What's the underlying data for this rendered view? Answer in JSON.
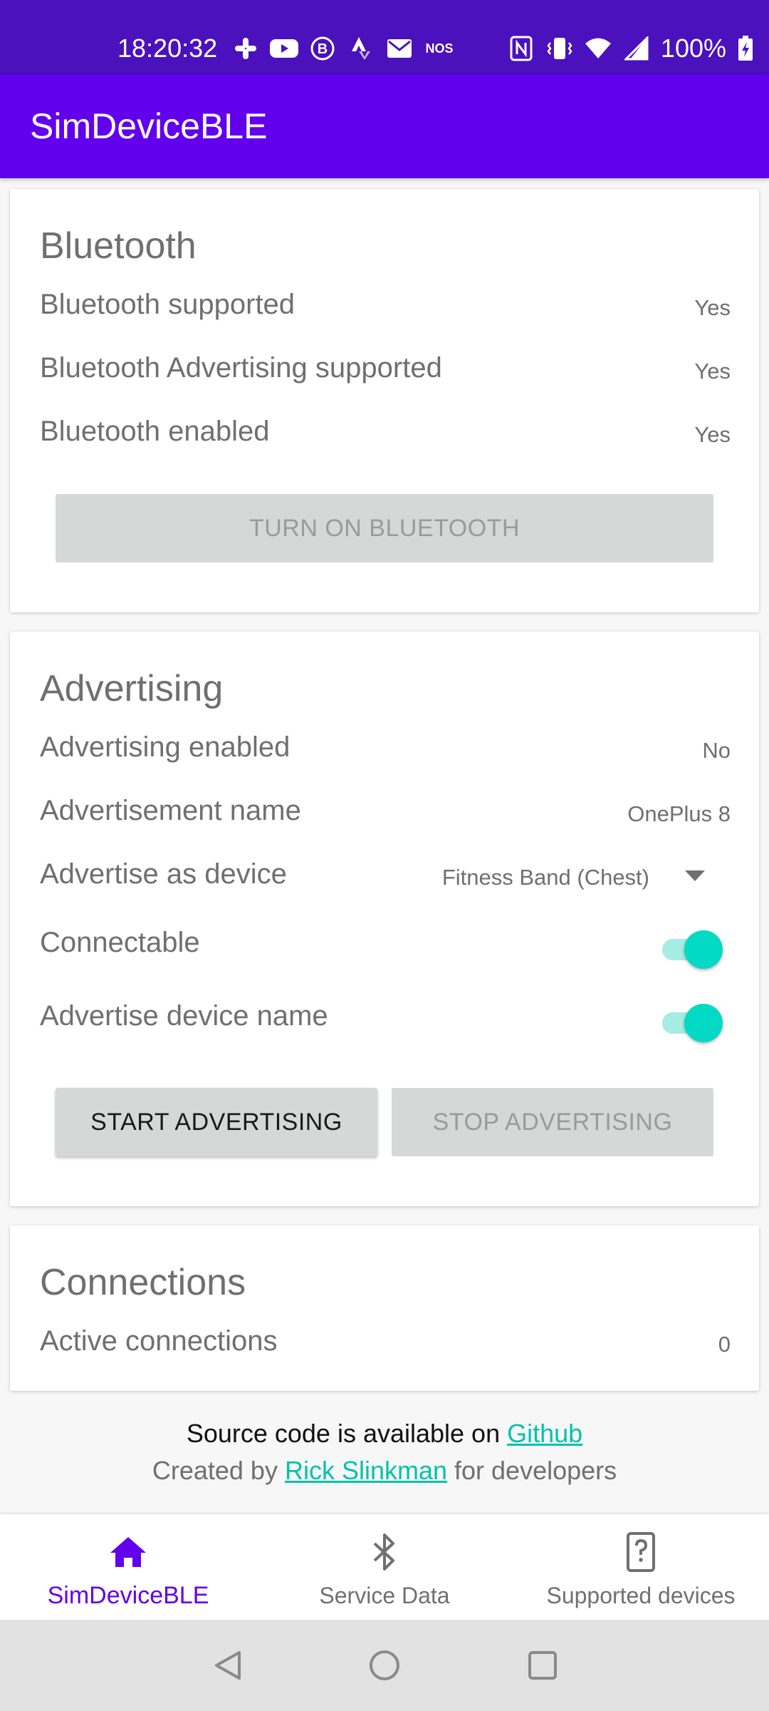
{
  "status_bar": {
    "time": "18:20:32",
    "battery": "100%",
    "left_icons": [
      "slack-icon",
      "youtube-icon",
      "b-circle-icon",
      "strava-icon",
      "gmail-icon",
      "nos-icon"
    ],
    "nos_text": "NOS",
    "right_icons": [
      "nfc-icon",
      "vibrate-icon",
      "wifi-icon",
      "signal-icon",
      "battery-charging-icon"
    ]
  },
  "app_bar": {
    "title": "SimDeviceBLE"
  },
  "bluetooth": {
    "title": "Bluetooth",
    "rows": [
      {
        "label": "Bluetooth supported",
        "value": "Yes"
      },
      {
        "label": "Bluetooth Advertising supported",
        "value": "Yes"
      },
      {
        "label": "Bluetooth enabled",
        "value": "Yes"
      }
    ],
    "button": "TURN ON BLUETOOTH"
  },
  "advertising": {
    "title": "Advertising",
    "enabled_label": "Advertising enabled",
    "enabled_value": "No",
    "name_label": "Advertisement name",
    "name_value": "OnePlus 8",
    "device_label": "Advertise as device",
    "device_value": "Fitness Band (Chest)",
    "connectable_label": "Connectable",
    "connectable_on": true,
    "adv_name_label": "Advertise device name",
    "adv_name_on": true,
    "start_button": "START ADVERTISING",
    "stop_button": "STOP ADVERTISING"
  },
  "connections": {
    "title": "Connections",
    "active_label": "Active connections",
    "active_value": "0"
  },
  "footer": {
    "line1_prefix": "Source code is available on ",
    "line1_link": "Github",
    "line2_prefix": "Created by ",
    "line2_link": "Rick Slinkman",
    "line2_suffix": " for developers"
  },
  "bottom_nav": {
    "items": [
      {
        "label": "SimDeviceBLE",
        "icon": "home-icon",
        "selected": true
      },
      {
        "label": "Service Data",
        "icon": "bluetooth-icon",
        "selected": false
      },
      {
        "label": "Supported devices",
        "icon": "device-unknown-icon",
        "selected": false
      }
    ]
  },
  "colors": {
    "primary": "#6200ee",
    "primary_dark": "#4a11bd",
    "accent": "#03dac5"
  }
}
